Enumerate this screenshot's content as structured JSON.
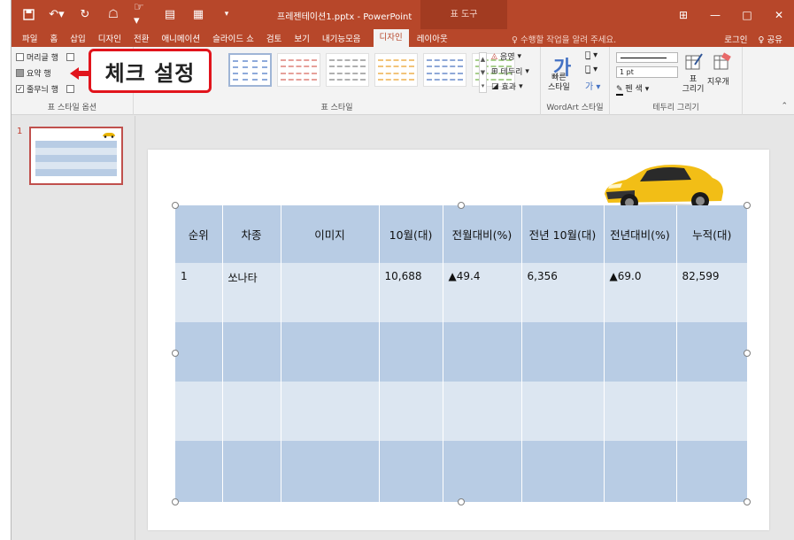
{
  "titlebar": {
    "doc_title": "프레젠테이션1.pptx - PowerPoint",
    "context_tab": "표 도구",
    "win_ribbon_opt": "⊞",
    "win_min": "—",
    "win_max": "□",
    "win_close": "✕"
  },
  "tabs": [
    "파일",
    "홈",
    "삽입",
    "디자인",
    "전환",
    "애니메이션",
    "슬라이드 쇼",
    "검토",
    "보기",
    "내기능모음",
    "디자인",
    "레이아웃"
  ],
  "active_tab": "디자인",
  "tell_me": "♀ 수행할 작업을 알려 주세요.",
  "account": {
    "login": "로그인",
    "share": "♀ 공유"
  },
  "ribbon": {
    "style_options": {
      "header_row": "머리글 행",
      "total_row": "요약 행",
      "banded_rows": "줄무늬 행",
      "group_label": "표 스타일 옵션"
    },
    "table_styles": {
      "group_label": "표 스타일",
      "shading": "음영",
      "borders": "테두리",
      "effects": "효과"
    },
    "wordart": {
      "quick_styles": "빠른\n스타일",
      "group_label": "WordArt 스타일"
    },
    "draw_borders": {
      "pen_weight": "1 pt",
      "pen_color": "펜 색",
      "draw_table": "표\n그리기",
      "eraser": "지우개",
      "group_label": "테두리 그리기"
    }
  },
  "callout": "체크 설정",
  "thumbnail": {
    "number": "1"
  },
  "table": {
    "headers": [
      "순위",
      "차종",
      "이미지",
      "10월(대)",
      "전월대비(%)",
      "전년 10월(대)",
      "전년대비(%)",
      "누적(대)"
    ],
    "rows": [
      [
        "1",
        "쏘나타",
        "",
        "10,688",
        "▲49.4",
        "6,356",
        "▲69.0",
        "82,599"
      ],
      [
        "",
        "",
        "",
        "",
        "",
        "",
        "",
        ""
      ],
      [
        "",
        "",
        "",
        "",
        "",
        "",
        "",
        ""
      ],
      [
        "",
        "",
        "",
        "",
        "",
        "",
        "",
        ""
      ]
    ]
  },
  "colors": {
    "brand": "#b7472a",
    "header_band": "#b8cce4",
    "light_band": "#dce6f1",
    "callout_border": "#e1141c"
  }
}
